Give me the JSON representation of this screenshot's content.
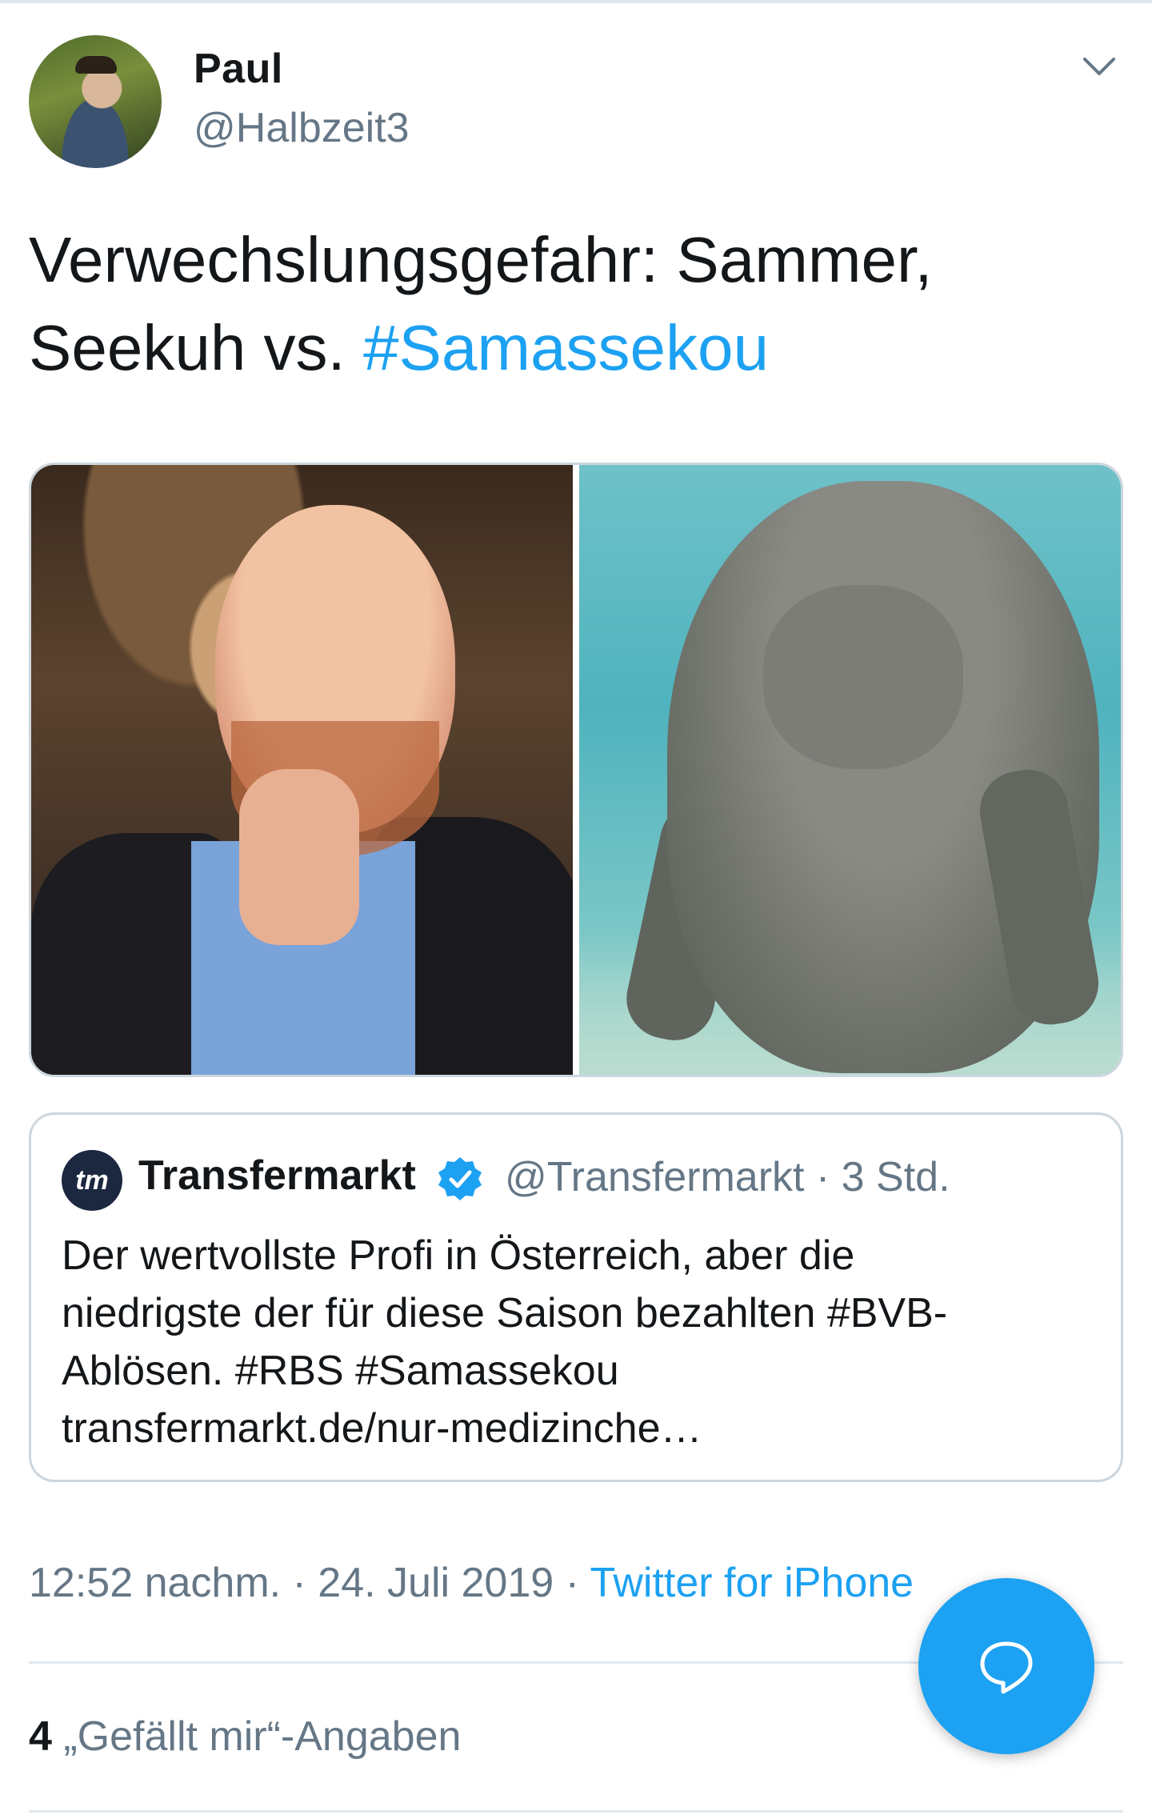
{
  "author": {
    "display_name": "Paul",
    "handle": "@Halbzeit3"
  },
  "tweet": {
    "text_line1": "Verwechslungsgefahr: Sammer,",
    "text_line2_plain": "Seekuh vs. ",
    "text_line2_hashtag": "#Samassekou"
  },
  "quoted_tweet": {
    "logo_text": "tm",
    "name": "Transfermarkt",
    "meta": "@Transfermarkt · 3 Std.",
    "text_line1": "Der wertvollste Profi in Österreich, aber die",
    "text_line2": "niedrigste der für diese Saison bezahlten #BVB-",
    "text_line3": "Ablösen. #RBS #Samassekou",
    "text_line4": "transfermarkt.de/nur-medizinche…"
  },
  "footer": {
    "timestamp": "12:52 nachm. · 24. Juli 2019 · ",
    "source": "Twitter for iPhone",
    "likes_count": "4",
    "likes_label": " „Gefällt mir“-Angaben"
  },
  "icons": {
    "menu": "chevron-down-icon",
    "verified": "verified-badge-icon",
    "reply": "reply-bubble-icon"
  },
  "colors": {
    "accent": "#1da1f2",
    "secondary_text": "#657786",
    "primary_text": "#14171a",
    "border": "#ccd6dd"
  }
}
